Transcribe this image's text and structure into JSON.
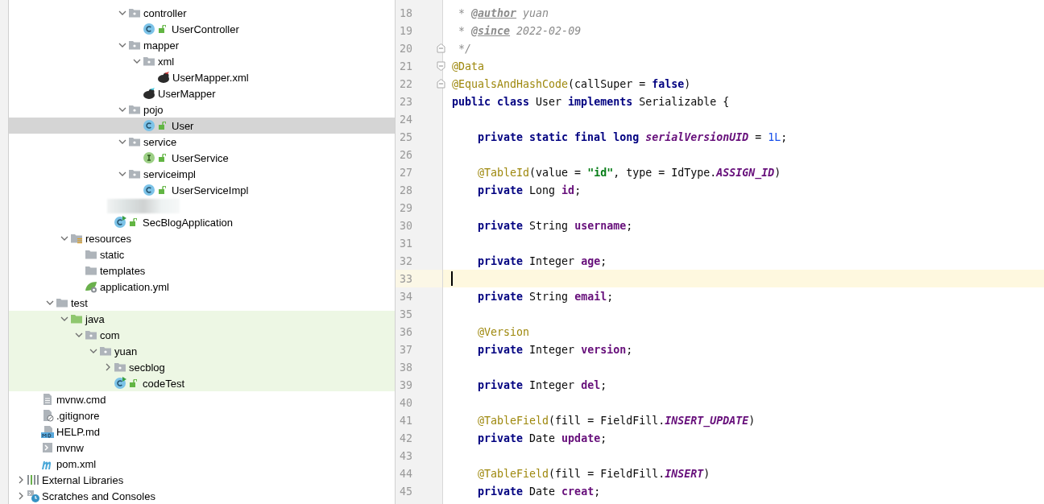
{
  "project_tree": {
    "items": [
      {
        "children": [
          {
            "children": [
              {
                "children": [
                  {
                    "children": [
                      {
                        "children": [
                          {
                            "children": [
                              {
                                "children": [
                                  {
                                    "label": "controller",
                                    "kind": "package",
                                    "expanded": true,
                                    "selected": false,
                                    "children": [
                                      {
                                        "label": "UserController",
                                        "kind": "class",
                                        "lock": true,
                                        "selected": false
                                      }
                                    ]
                                  },
                                  {
                                    "label": "mapper",
                                    "kind": "package",
                                    "expanded": true,
                                    "selected": false,
                                    "children": [
                                      {
                                        "label": "xml",
                                        "kind": "package",
                                        "expanded": true,
                                        "selected": false,
                                        "children": [
                                          {
                                            "label": "UserMapper.xml",
                                            "kind": "mybatis-xml",
                                            "selected": false
                                          }
                                        ]
                                      },
                                      {
                                        "label": "UserMapper",
                                        "kind": "mybatis",
                                        "selected": false
                                      }
                                    ]
                                  },
                                  {
                                    "label": "pojo",
                                    "kind": "package",
                                    "expanded": true,
                                    "selected": false,
                                    "children": [
                                      {
                                        "label": "User",
                                        "kind": "class",
                                        "lock": true,
                                        "selected": true
                                      }
                                    ]
                                  },
                                  {
                                    "label": "service",
                                    "kind": "package",
                                    "expanded": true,
                                    "selected": false,
                                    "children": [
                                      {
                                        "label": "UserService",
                                        "kind": "interface",
                                        "lock": true,
                                        "selected": false
                                      }
                                    ]
                                  },
                                  {
                                    "label": "serviceimpl",
                                    "kind": "package",
                                    "expanded": true,
                                    "selected": false,
                                    "children": [
                                      {
                                        "label": "UserServiceImpl",
                                        "kind": "class",
                                        "lock": true,
                                        "selected": false
                                      }
                                    ]
                                  }
                                ]
                              },
                              {
                                "kind": "blurred"
                              },
                              {
                                "label": "SecBlogApplication",
                                "kind": "class-run",
                                "lock": true,
                                "selected": false
                              }
                            ]
                          }
                        ]
                      }
                    ]
                  },
                  {
                    "label": "resources",
                    "kind": "resources",
                    "expanded": true,
                    "selected": false,
                    "children": [
                      {
                        "label": "static",
                        "kind": "folder",
                        "selected": false
                      },
                      {
                        "label": "templates",
                        "kind": "folder",
                        "selected": false
                      },
                      {
                        "label": "application.yml",
                        "kind": "spring-config",
                        "selected": false
                      }
                    ]
                  }
                ]
              },
              {
                "label": "test",
                "kind": "folder",
                "expanded": true,
                "selected": false,
                "children": [
                  {
                    "label": "java",
                    "kind": "test-root",
                    "expanded": true,
                    "test_scope": true,
                    "selected": false,
                    "children": [
                      {
                        "label": "com",
                        "kind": "package",
                        "expanded": true,
                        "selected": false,
                        "children": [
                          {
                            "label": "yuan",
                            "kind": "package",
                            "expanded": true,
                            "selected": false,
                            "children": [
                              {
                                "label": "secblog",
                                "kind": "package",
                                "expanded": false,
                                "selected": false
                              },
                              {
                                "label": "codeTest",
                                "kind": "class-run",
                                "lock": true,
                                "selected": false
                              }
                            ]
                          }
                        ]
                      }
                    ]
                  }
                ]
              }
            ]
          },
          {
            "label": "mvnw.cmd",
            "kind": "text-file",
            "selected": false
          },
          {
            "label": ".gitignore",
            "kind": "gitignore",
            "selected": false
          },
          {
            "label": "HELP.md",
            "kind": "markdown",
            "selected": false
          },
          {
            "label": "mvnw",
            "kind": "script",
            "selected": false
          },
          {
            "label": "pom.xml",
            "kind": "maven",
            "selected": false
          }
        ]
      },
      {
        "label": "External Libraries",
        "kind": "libraries",
        "expanded": false,
        "selected": false
      },
      {
        "label": "Scratches and Consoles",
        "kind": "scratches",
        "expanded": false,
        "selected": false
      }
    ]
  },
  "editor": {
    "lines": [
      {
        "number": "18",
        "current": false,
        "tokens": [
          {
            "text": " * ",
            "kind": "comment"
          },
          {
            "text": "@author",
            "kind": "doc-tag"
          },
          {
            "text": " yuan",
            "kind": "comment"
          }
        ]
      },
      {
        "number": "19",
        "current": false,
        "tokens": [
          {
            "text": " * ",
            "kind": "comment"
          },
          {
            "text": "@since",
            "kind": "doc-tag"
          },
          {
            "text": " 2022-02-09",
            "kind": "comment"
          }
        ]
      },
      {
        "number": "20",
        "current": false,
        "fold_close": true,
        "tokens": [
          {
            "text": " */",
            "kind": "comment"
          }
        ]
      },
      {
        "number": "21",
        "current": false,
        "fold_open": true,
        "tokens": [
          {
            "text": "@Data",
            "kind": "annotation"
          }
        ]
      },
      {
        "number": "22",
        "current": false,
        "fold_close": true,
        "tokens": [
          {
            "text": "@EqualsAndHashCode",
            "kind": "annotation"
          },
          {
            "text": "(callSuper = ",
            "kind": "plain"
          },
          {
            "text": "false",
            "kind": "keyword"
          },
          {
            "text": ")",
            "kind": "plain"
          }
        ]
      },
      {
        "number": "23",
        "current": false,
        "tokens": [
          {
            "text": "public class ",
            "kind": "keyword"
          },
          {
            "text": "User ",
            "kind": "plain"
          },
          {
            "text": "implements ",
            "kind": "keyword"
          },
          {
            "text": "Serializable {",
            "kind": "plain"
          }
        ]
      },
      {
        "number": "24",
        "current": false
      },
      {
        "number": "25",
        "current": false,
        "tokens": [
          {
            "text": "    private static final long ",
            "kind": "keyword"
          },
          {
            "text": "serialVersionUID",
            "kind": "static-field"
          },
          {
            "text": " = ",
            "kind": "plain"
          },
          {
            "text": "1L",
            "kind": "number"
          },
          {
            "text": ";",
            "kind": "plain"
          }
        ]
      },
      {
        "number": "26",
        "current": false
      },
      {
        "number": "27",
        "current": false,
        "tokens": [
          {
            "text": "    @TableId",
            "kind": "annotation"
          },
          {
            "text": "(value = ",
            "kind": "plain"
          },
          {
            "text": "\"id\"",
            "kind": "string"
          },
          {
            "text": ", type = IdType.",
            "kind": "plain"
          },
          {
            "text": "ASSIGN_ID",
            "kind": "static-field"
          },
          {
            "text": ")",
            "kind": "plain"
          }
        ]
      },
      {
        "number": "28",
        "current": false,
        "tokens": [
          {
            "text": "    private ",
            "kind": "keyword"
          },
          {
            "text": "Long ",
            "kind": "plain"
          },
          {
            "text": "id",
            "kind": "field"
          },
          {
            "text": ";",
            "kind": "plain"
          }
        ]
      },
      {
        "number": "29",
        "current": false
      },
      {
        "number": "30",
        "current": false,
        "tokens": [
          {
            "text": "    private ",
            "kind": "keyword"
          },
          {
            "text": "String ",
            "kind": "plain"
          },
          {
            "text": "username",
            "kind": "field"
          },
          {
            "text": ";",
            "kind": "plain"
          }
        ]
      },
      {
        "number": "31",
        "current": false
      },
      {
        "number": "32",
        "current": false,
        "tokens": [
          {
            "text": "    private ",
            "kind": "keyword"
          },
          {
            "text": "Integer ",
            "kind": "plain"
          },
          {
            "text": "age",
            "kind": "field"
          },
          {
            "text": ";",
            "kind": "plain"
          }
        ]
      },
      {
        "number": "33",
        "current": true
      },
      {
        "number": "34",
        "current": false,
        "tokens": [
          {
            "text": "    private ",
            "kind": "keyword"
          },
          {
            "text": "String ",
            "kind": "plain"
          },
          {
            "text": "email",
            "kind": "field"
          },
          {
            "text": ";",
            "kind": "plain"
          }
        ]
      },
      {
        "number": "35",
        "current": false
      },
      {
        "number": "36",
        "current": false,
        "tokens": [
          {
            "text": "    @Version",
            "kind": "annotation"
          }
        ]
      },
      {
        "number": "37",
        "current": false,
        "tokens": [
          {
            "text": "    private ",
            "kind": "keyword"
          },
          {
            "text": "Integer ",
            "kind": "plain"
          },
          {
            "text": "version",
            "kind": "field"
          },
          {
            "text": ";",
            "kind": "plain"
          }
        ]
      },
      {
        "number": "38",
        "current": false
      },
      {
        "number": "39",
        "current": false,
        "tokens": [
          {
            "text": "    private ",
            "kind": "keyword"
          },
          {
            "text": "Integer ",
            "kind": "plain"
          },
          {
            "text": "del",
            "kind": "field"
          },
          {
            "text": ";",
            "kind": "plain"
          }
        ]
      },
      {
        "number": "40",
        "current": false
      },
      {
        "number": "41",
        "current": false,
        "tokens": [
          {
            "text": "    @TableField",
            "kind": "annotation"
          },
          {
            "text": "(fill = FieldFill.",
            "kind": "plain"
          },
          {
            "text": "INSERT_UPDATE",
            "kind": "static-field"
          },
          {
            "text": ")",
            "kind": "plain"
          }
        ]
      },
      {
        "number": "42",
        "current": false,
        "tokens": [
          {
            "text": "    private ",
            "kind": "keyword"
          },
          {
            "text": "Date ",
            "kind": "plain"
          },
          {
            "text": "update",
            "kind": "field"
          },
          {
            "text": ";",
            "kind": "plain"
          }
        ]
      },
      {
        "number": "43",
        "current": false
      },
      {
        "number": "44",
        "current": false,
        "tokens": [
          {
            "text": "    @TableField",
            "kind": "annotation"
          },
          {
            "text": "(fill = FieldFill.",
            "kind": "plain"
          },
          {
            "text": "INSERT",
            "kind": "static-field"
          },
          {
            "text": ")",
            "kind": "plain"
          }
        ]
      },
      {
        "number": "45",
        "current": false,
        "tokens": [
          {
            "text": "    private ",
            "kind": "keyword"
          },
          {
            "text": "Date ",
            "kind": "plain"
          },
          {
            "text": "creat",
            "kind": "field"
          },
          {
            "text": ";",
            "kind": "plain"
          }
        ]
      }
    ]
  }
}
